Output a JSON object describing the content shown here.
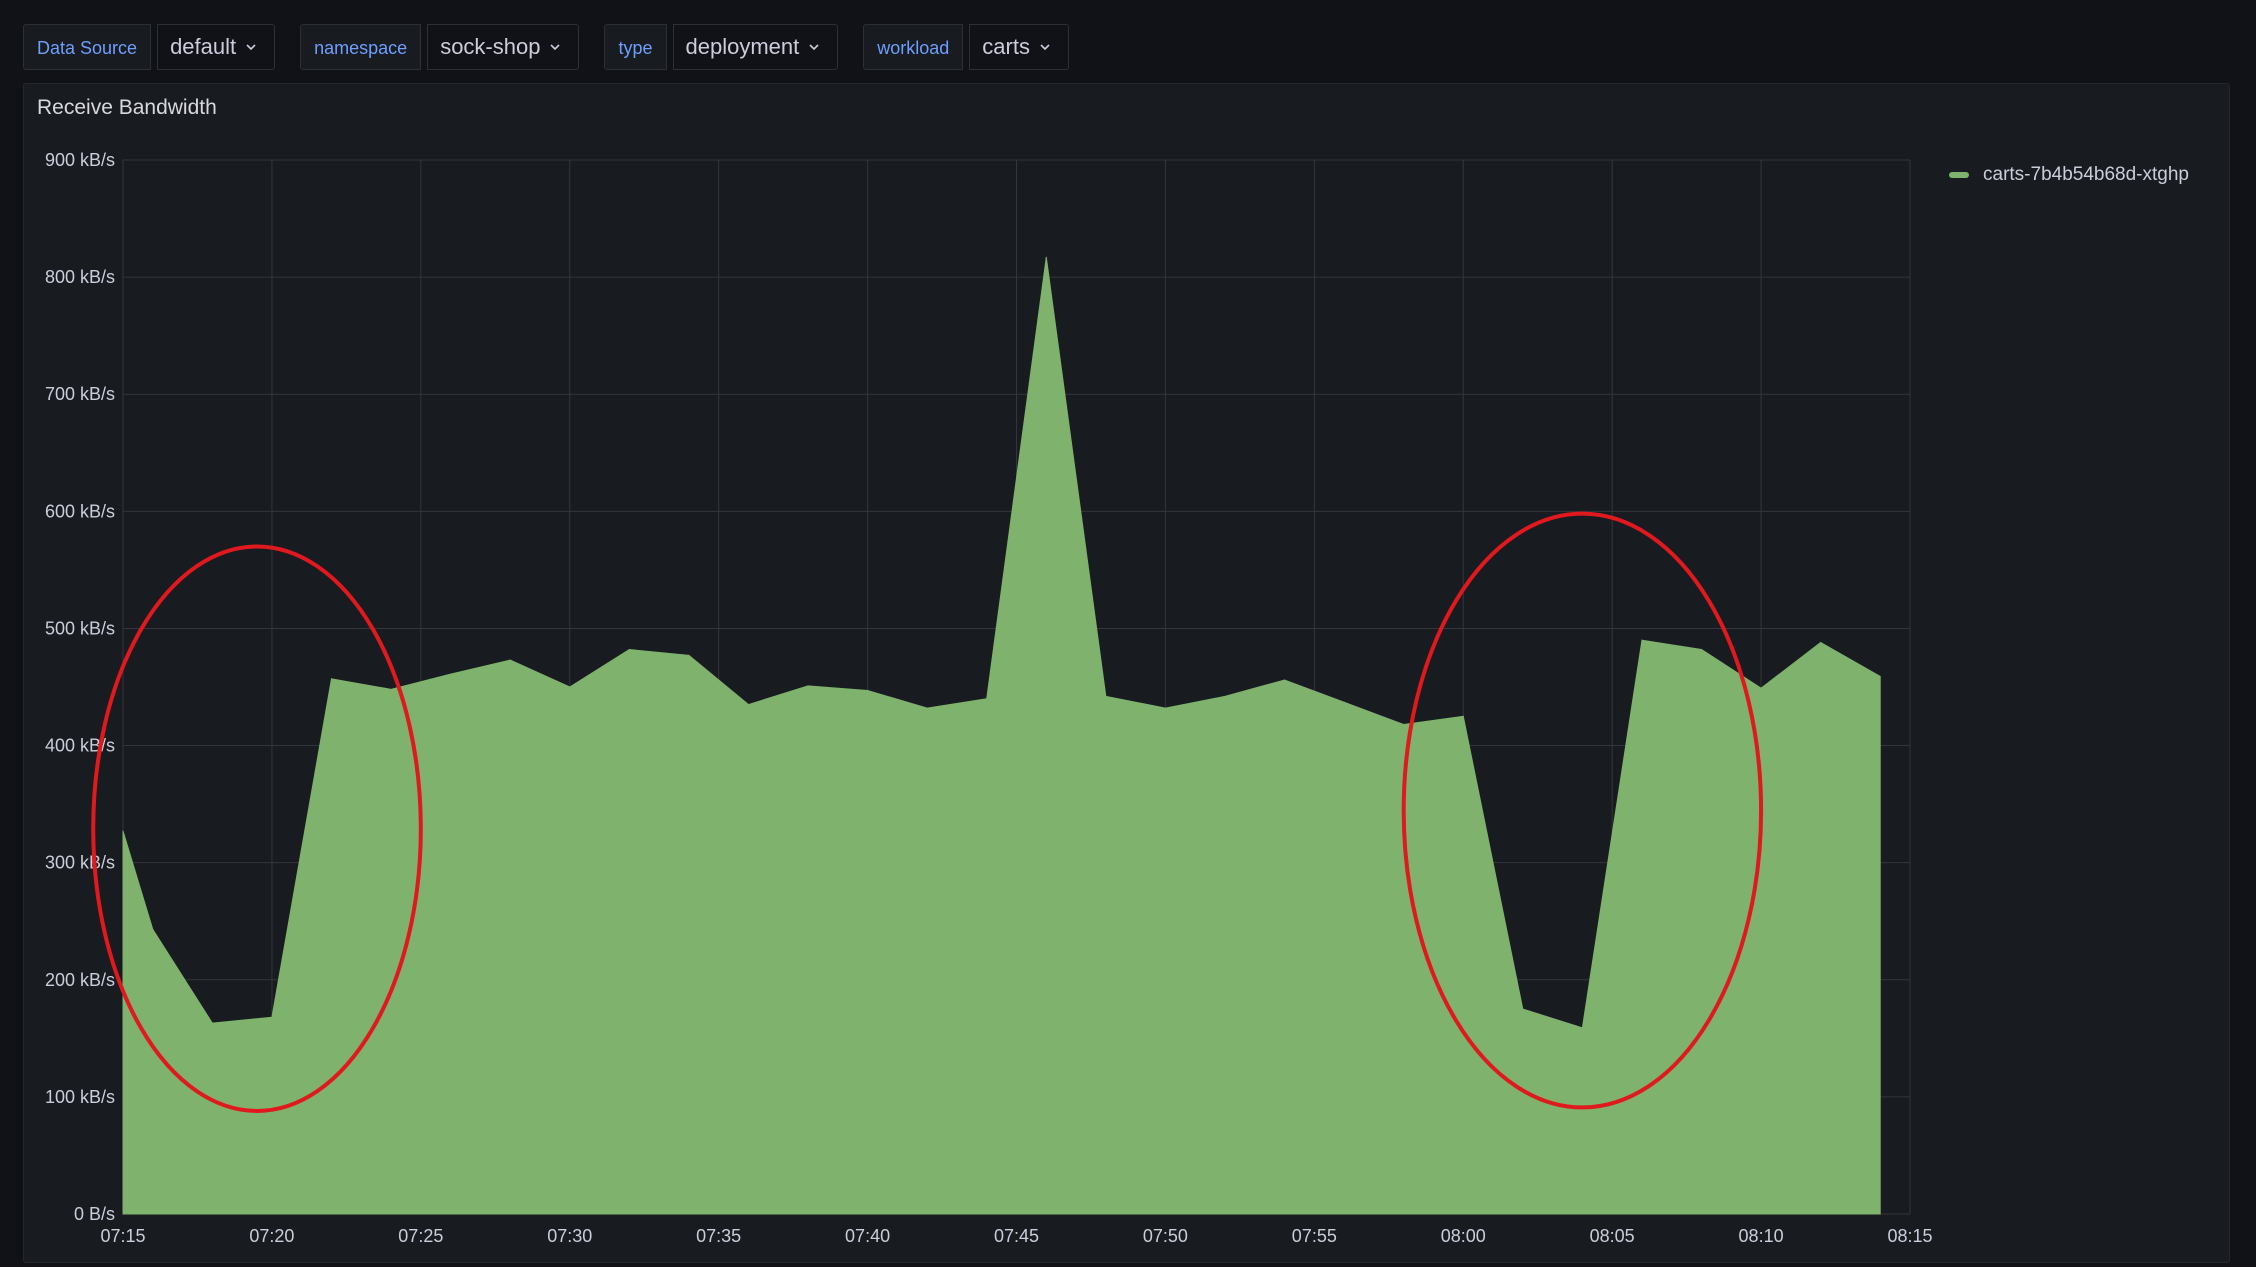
{
  "variables": [
    {
      "label": "Data Source",
      "value": "default"
    },
    {
      "label": "namespace",
      "value": "sock-shop"
    },
    {
      "label": "type",
      "value": "deployment"
    },
    {
      "label": "workload",
      "value": "carts"
    }
  ],
  "panel": {
    "title": "Receive Bandwidth"
  },
  "colors": {
    "series": "#7eb26d",
    "annotation": "#e0191e",
    "grid": "#33363c"
  },
  "icons": {
    "dropdown": "chevron-down-icon"
  },
  "chart_data": {
    "type": "area",
    "title": "Receive Bandwidth",
    "xlabel": "",
    "ylabel": "",
    "x_range": [
      "07:15",
      "08:15"
    ],
    "x_ticks": [
      "07:15",
      "07:20",
      "07:25",
      "07:30",
      "07:35",
      "07:40",
      "07:45",
      "07:50",
      "07:55",
      "08:00",
      "08:05",
      "08:10",
      "08:15"
    ],
    "y_ticks": [
      "0 B/s",
      "100 kB/s",
      "200 kB/s",
      "300 kB/s",
      "400 kB/s",
      "500 kB/s",
      "600 kB/s",
      "700 kB/s",
      "800 kB/s",
      "900 kB/s"
    ],
    "ylim": [
      0,
      900
    ],
    "y_unit": "kB/s",
    "grid": true,
    "legend_position": "right",
    "series": [
      {
        "name": "carts-7b4b54b68d-xtghp",
        "x": [
          "07:15",
          "07:16",
          "07:18",
          "07:20",
          "07:22",
          "07:24",
          "07:26",
          "07:28",
          "07:30",
          "07:32",
          "07:34",
          "07:36",
          "07:38",
          "07:40",
          "07:42",
          "07:44",
          "07:46",
          "07:48",
          "07:50",
          "07:52",
          "07:54",
          "07:56",
          "07:58",
          "08:00",
          "08:02",
          "08:04",
          "08:06",
          "08:08",
          "08:10",
          "08:12",
          "08:14"
        ],
        "values": [
          327,
          243,
          163,
          168,
          457,
          448,
          461,
          473,
          450,
          482,
          477,
          435,
          451,
          447,
          432,
          440,
          817,
          442,
          432,
          442,
          456,
          437,
          418,
          425,
          175,
          159,
          490,
          482,
          449,
          488,
          459
        ]
      }
    ],
    "annotations": [
      {
        "shape": "ellipse",
        "x_range": [
          "07:14",
          "07:25"
        ],
        "y_range": [
          88,
          570
        ]
      },
      {
        "shape": "ellipse",
        "x_range": [
          "07:58",
          "08:10"
        ],
        "y_range": [
          91,
          598
        ]
      }
    ]
  }
}
